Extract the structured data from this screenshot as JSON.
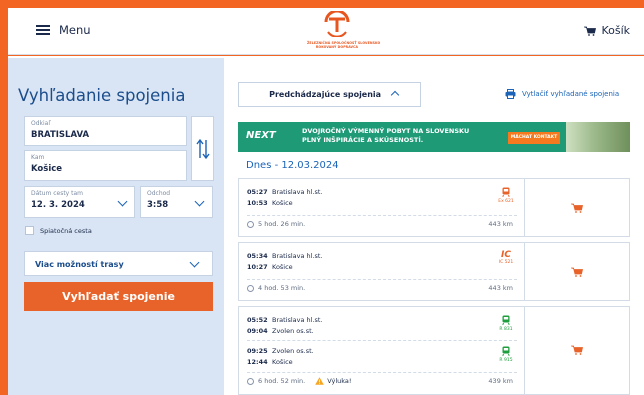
{
  "header": {
    "menu_label": "Menu",
    "logo_line1": "ŽELEZNIČNÁ SPOLOČNOSŤ SLOVENSKO",
    "logo_line2": "ROKOVANÝ DOPRAVCA",
    "cart_label": "Košík"
  },
  "search": {
    "title": "Vyhľadanie spojenia",
    "from_label": "Odkiaľ",
    "from_value": "BRATISLAVA",
    "to_label": "Kam",
    "to_value": "Košice",
    "date_label": "Dátum cesty tam",
    "date_value": "12. 3. 2024",
    "time_label": "Odchod",
    "time_value": "3:58",
    "return_label": "Spiatočná cesta",
    "more_options": "Viac možností trasy",
    "search_button": "Vyhľadať spojenie"
  },
  "results": {
    "prev_button": "Predchádzajúce spojenia",
    "print_label": "Vytlačiť vyhľadané spojenia",
    "banner": {
      "brand": "NEXT",
      "line1": "DVOJROČNÝ VÝMENNÝ POBYT NA SLOVENSKU",
      "line2": "PLNÝ INŠPIRÁCIE A SKÚSENOSTÍ.",
      "cta": "MÁCHAT KONTAKT"
    },
    "date_heading": "Dnes - 12.03.2024",
    "connections": [
      {
        "legs": [
          {
            "dep_time": "05:27",
            "dep_station": "Bratislava hl.st.",
            "arr_time": "10:53",
            "arr_station": "Košice",
            "train": "Ex 621"
          }
        ],
        "duration": "5 hod. 26 min.",
        "distance": "443 km"
      },
      {
        "legs": [
          {
            "dep_time": "05:34",
            "dep_station": "Bratislava hl.st.",
            "arr_time": "10:27",
            "arr_station": "Košice",
            "train": "IC 521"
          }
        ],
        "duration": "4 hod. 53 min.",
        "distance": "443 km"
      },
      {
        "legs": [
          {
            "dep_time": "05:52",
            "dep_station": "Bratislava hl.st.",
            "arr_time": "09:04",
            "arr_station": "Zvolen os.st.",
            "train": "R 831"
          },
          {
            "dep_time": "09:25",
            "dep_station": "Zvolen os.st.",
            "arr_time": "12:44",
            "arr_station": "Košice",
            "train": "R 915"
          }
        ],
        "duration": "6 hod. 52 min.",
        "warning": "Výluka!",
        "distance": "439 km"
      }
    ]
  },
  "colors": {
    "accent": "#e8632a",
    "link": "#1b64b8",
    "panel": "#d9e5f4",
    "banner": "#1f9a77",
    "train_green": "#1e9e3c"
  },
  "icons": [
    "hamburger-icon",
    "logo",
    "cart-icon",
    "swap-icon",
    "chevron-down-icon",
    "chevron-up-icon",
    "printer-icon",
    "train-icon",
    "ic-icon",
    "clock-icon",
    "warning-icon"
  ]
}
